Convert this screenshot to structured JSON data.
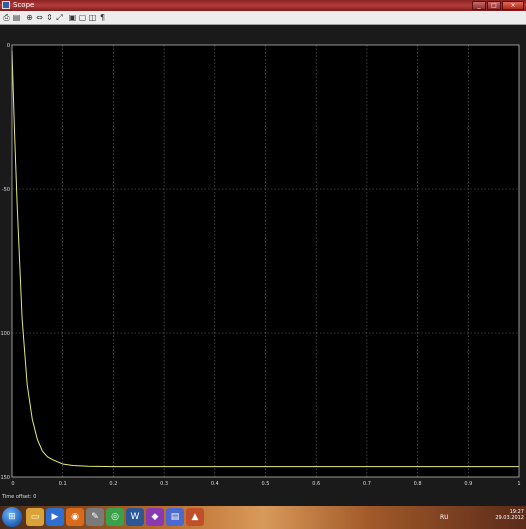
{
  "window": {
    "title": "Scope"
  },
  "toolbar": {
    "buttons": [
      {
        "name": "print-button",
        "glyph": "⎙"
      },
      {
        "name": "parameters-button",
        "glyph": "▤"
      },
      {
        "name": "zoom-button",
        "glyph": "⊕"
      },
      {
        "name": "zoom-x-button",
        "glyph": "⇔"
      },
      {
        "name": "zoom-y-button",
        "glyph": "⇕"
      },
      {
        "name": "autoscale-button",
        "glyph": "⤢"
      },
      {
        "name": "save-axes-button",
        "glyph": "▣"
      },
      {
        "name": "restore-axes-button",
        "glyph": "▢"
      },
      {
        "name": "floating-scope-button",
        "glyph": "◫"
      },
      {
        "name": "signal-selector-button",
        "glyph": "¶"
      }
    ]
  },
  "scope": {
    "time_offset_label": "Time offset:",
    "time_offset_value": "0"
  },
  "chart_data": {
    "type": "line",
    "xlim": [
      0,
      1
    ],
    "ylim": [
      -150,
      0
    ],
    "xticks": [
      "0",
      "0.1",
      "0.2",
      "0.3",
      "0.4",
      "0.5",
      "0.6",
      "0.7",
      "0.8",
      "0.9",
      "1"
    ],
    "yticks": [
      "0",
      "-50",
      "-100",
      "-150"
    ],
    "grid": true,
    "background": "#000000",
    "line_color": "#e8e87a",
    "grid_color": "#6a6a6a",
    "series": [
      {
        "x": [
          0,
          0.005,
          0.01,
          0.015,
          0.02,
          0.03,
          0.04,
          0.05,
          0.06,
          0.07,
          0.08,
          0.1,
          0.12,
          0.15,
          0.2,
          0.3,
          0.5,
          0.8,
          1.0
        ],
        "y": [
          -2,
          -30,
          -55,
          -75,
          -95,
          -118,
          -130,
          -137,
          -141,
          -143,
          -144,
          -145.5,
          -146,
          -146.3,
          -146.4,
          -146.4,
          -146.4,
          -146.4,
          -146.4
        ]
      }
    ]
  },
  "taskbar": {
    "apps": [
      {
        "name": "explorer-taskbar-icon",
        "glyph": "▭",
        "color": "#d9a33a"
      },
      {
        "name": "media-taskbar-icon",
        "glyph": "▶",
        "color": "#2f6fd0"
      },
      {
        "name": "firefox-taskbar-icon",
        "glyph": "◉",
        "color": "#d96a1a"
      },
      {
        "name": "tool-taskbar-icon",
        "glyph": "✎",
        "color": "#7a7a7a"
      },
      {
        "name": "chrome-taskbar-icon",
        "glyph": "◎",
        "color": "#3aa04a"
      },
      {
        "name": "word-taskbar-icon",
        "glyph": "W",
        "color": "#2b5797"
      },
      {
        "name": "app-taskbar-icon",
        "glyph": "◆",
        "color": "#8a3ab0"
      },
      {
        "name": "files-taskbar-icon",
        "glyph": "▤",
        "color": "#4a6ad0"
      },
      {
        "name": "matlab-taskbar-icon",
        "glyph": "▲",
        "color": "#c0502a"
      }
    ],
    "language": "RU",
    "time": "19:27",
    "date": "29.03.2012"
  }
}
